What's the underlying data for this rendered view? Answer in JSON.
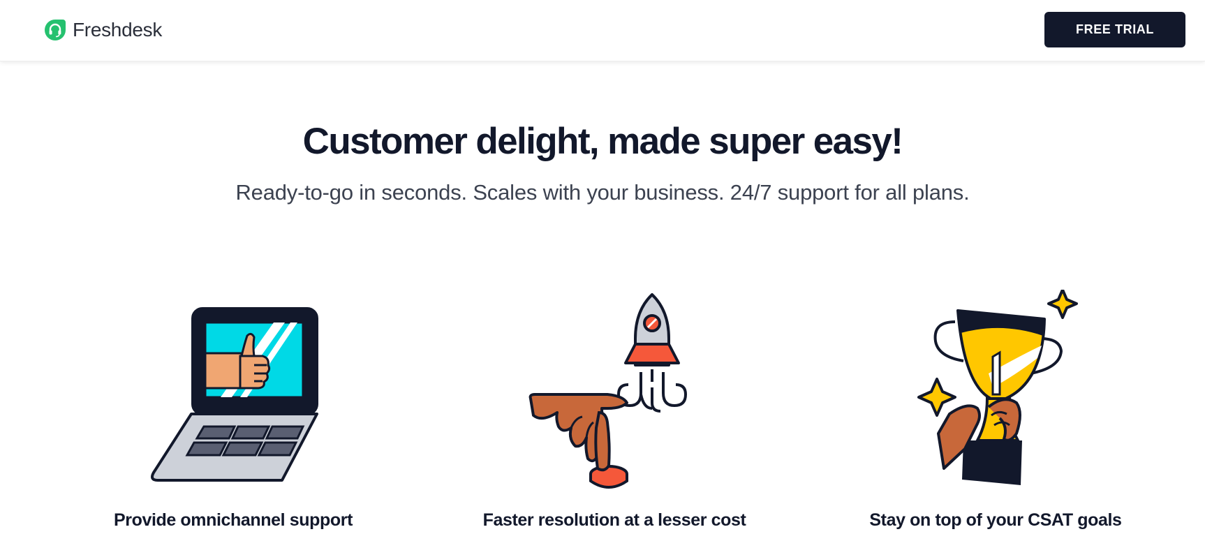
{
  "header": {
    "logo_text": "Freshdesk",
    "cta_label": "FREE TRIAL"
  },
  "hero": {
    "title": "Customer delight, made super easy!",
    "subtitle": "Ready-to-go in seconds. Scales with your business. 24/7 support for all plans."
  },
  "features": [
    {
      "label": "Provide omnichannel support",
      "icon": "laptop-thumbs-up-icon"
    },
    {
      "label": "Faster resolution at a lesser cost",
      "icon": "rocket-launch-button-icon"
    },
    {
      "label": "Stay on top of your CSAT goals",
      "icon": "trophy-icon"
    }
  ],
  "colors": {
    "brand_green": "#25c16f",
    "dark": "#12182b",
    "cyan": "#00d9e6",
    "orange": "#f5583a",
    "yellow": "#ffc700",
    "skin_light": "#f0a672",
    "skin_dark": "#c8683a"
  }
}
